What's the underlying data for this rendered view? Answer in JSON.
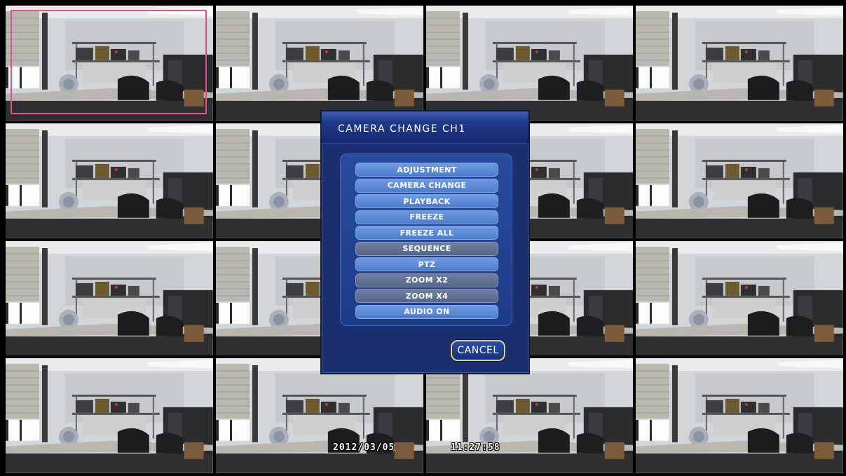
{
  "dialog": {
    "title": "CAMERA CHANGE CH1",
    "menu": [
      {
        "label": "ADJUSTMENT",
        "enabled": true
      },
      {
        "label": "CAMERA CHANGE",
        "enabled": true
      },
      {
        "label": "PLAYBACK",
        "enabled": true
      },
      {
        "label": "FREEZE",
        "enabled": true
      },
      {
        "label": "FREEZE ALL",
        "enabled": true
      },
      {
        "label": "SEQUENCE",
        "enabled": false
      },
      {
        "label": "PTZ",
        "enabled": true
      },
      {
        "label": "ZOOM X2",
        "enabled": false
      },
      {
        "label": "ZOOM X4",
        "enabled": false
      },
      {
        "label": "AUDIO ON",
        "enabled": true
      }
    ],
    "cancel_label": "CANCEL"
  },
  "overlay": {
    "date": "2012/03/05",
    "time": "11:27:58"
  },
  "grid": {
    "channels": 16,
    "selected_channel": 1
  },
  "colors": {
    "selection_border": "#e0508a",
    "dialog_bg": "#1a2f70",
    "menu_item": "#5f8cd8",
    "menu_item_disabled": "#62739a",
    "cancel_border": "#ded28a"
  }
}
